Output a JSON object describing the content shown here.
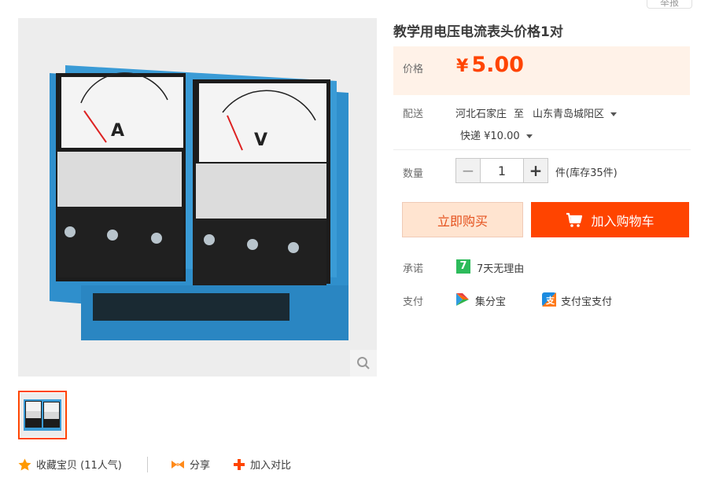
{
  "header": {
    "report_label": "举报"
  },
  "product": {
    "title": "教学用电压电流表头价格1对",
    "image_alt": "A 和 V 电表",
    "meter_a_letter": "A",
    "meter_v_letter": "V"
  },
  "price": {
    "label": "价格",
    "currency": "¥",
    "amount": "5.00"
  },
  "shipping": {
    "label": "配送",
    "from": "河北石家庄",
    "to_word": "至",
    "destination": "山东青岛城阳区",
    "method": "快递 ¥10.00"
  },
  "quantity": {
    "label": "数量",
    "minus": "−",
    "plus": "+",
    "value": "1",
    "stock_text": "件(库存35件)"
  },
  "actions": {
    "buy_now": "立即购买",
    "add_cart": "加入购物车"
  },
  "promise": {
    "label": "承诺",
    "badge": "7",
    "text": "7天无理由"
  },
  "payment": {
    "label": "支付",
    "method1": "集分宝",
    "method2": "支付宝支付"
  },
  "bottom": {
    "favorite": "收藏宝贝 (11人气)",
    "share": "分享",
    "compare": "加入对比"
  },
  "colors": {
    "accent": "#ff4400",
    "price_bg": "#fff2e8",
    "buy_now_bg": "#ffe4d0",
    "promise_green": "#2dbb5b"
  }
}
